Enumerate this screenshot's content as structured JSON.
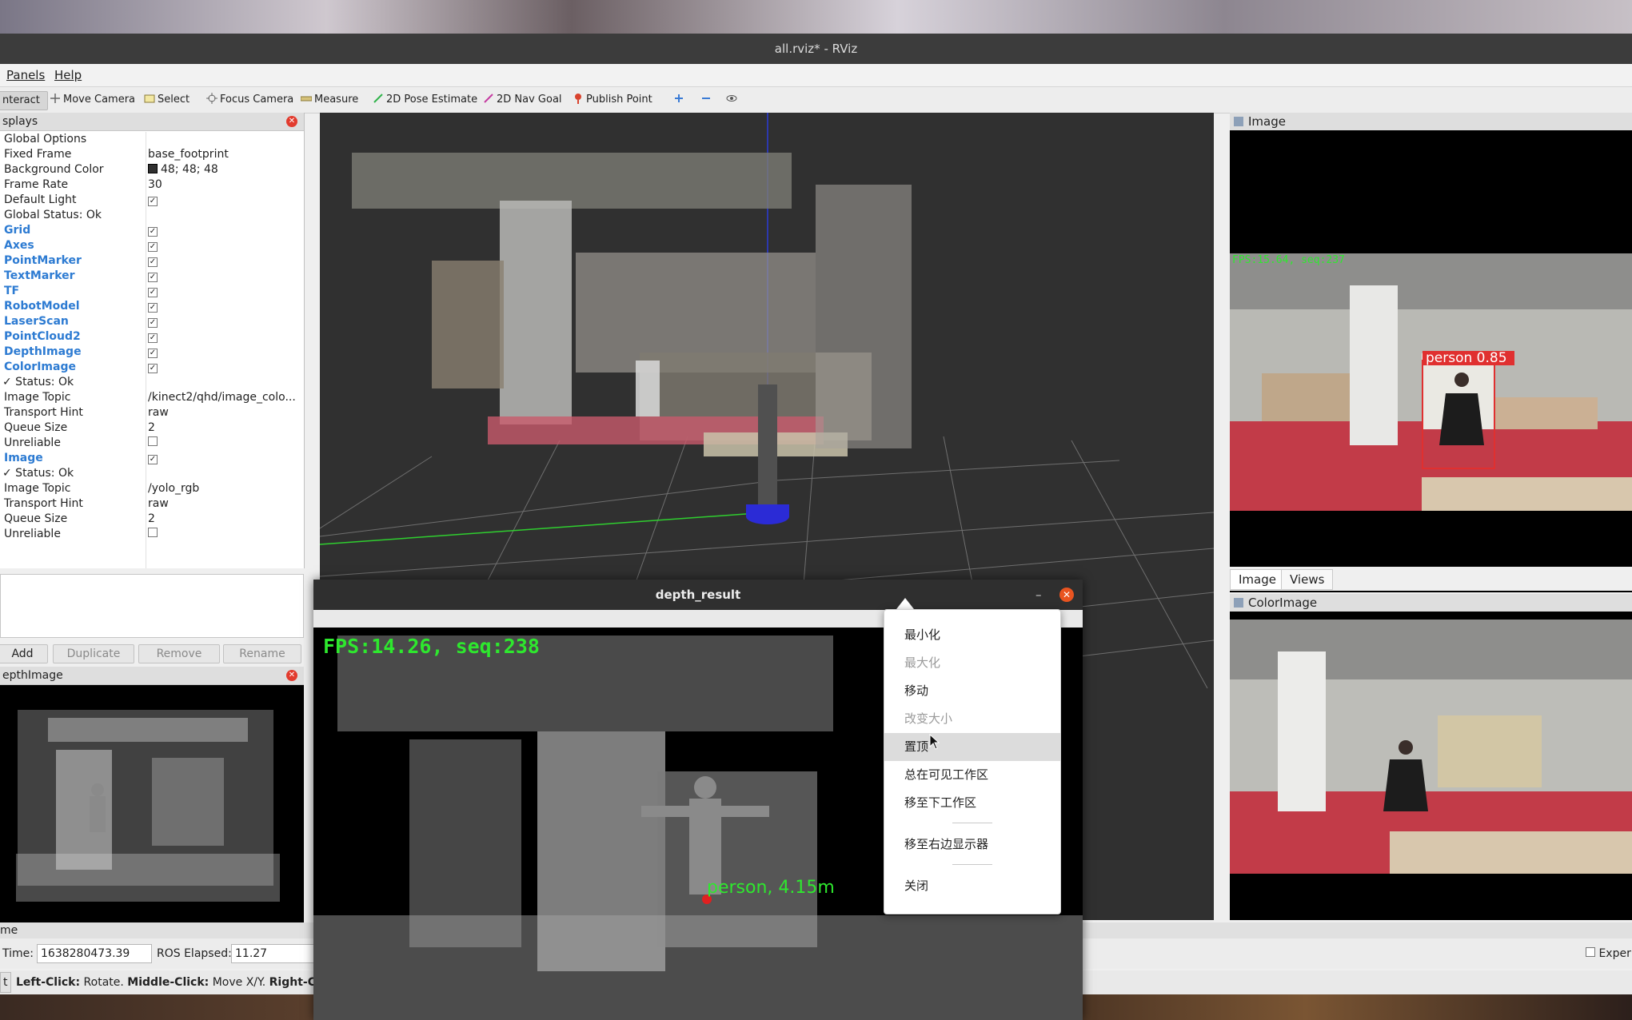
{
  "window": {
    "title": "all.rviz* - RViz"
  },
  "menubar": {
    "items": [
      "Panels",
      "Help"
    ]
  },
  "toolbar": {
    "tools": [
      {
        "label": "nteract",
        "icon": "hand-icon",
        "active": true
      },
      {
        "label": "Move Camera",
        "icon": "move-camera-icon"
      },
      {
        "label": "Select",
        "icon": "select-icon"
      },
      {
        "label": "Focus Camera",
        "icon": "focus-camera-icon"
      },
      {
        "label": "Measure",
        "icon": "measure-icon"
      },
      {
        "label": "2D Pose Estimate",
        "icon": "pose-estimate-icon",
        "color": "#2fb34a"
      },
      {
        "label": "2D Nav Goal",
        "icon": "nav-goal-icon",
        "color": "#c53aa0"
      },
      {
        "label": "Publish Point",
        "icon": "publish-point-icon",
        "color": "#d9432e"
      }
    ]
  },
  "displays": {
    "title": "splays",
    "rows": [
      {
        "key": "Global Options",
        "value": ""
      },
      {
        "key": "Fixed Frame",
        "value": "base_footprint"
      },
      {
        "key": "Background Color",
        "value": "48; 48; 48",
        "swatch": "#303030"
      },
      {
        "key": "Frame Rate",
        "value": "30"
      },
      {
        "key": "Default Light",
        "value": "✓"
      },
      {
        "key": "Global Status: Ok",
        "value": ""
      },
      {
        "key": "Grid",
        "value": "✓",
        "blue": true
      },
      {
        "key": "Axes",
        "value": "✓",
        "blue": true
      },
      {
        "key": "PointMarker",
        "value": "✓",
        "blue": true
      },
      {
        "key": "TextMarker",
        "value": "✓",
        "blue": true
      },
      {
        "key": "TF",
        "value": "✓",
        "blue": true
      },
      {
        "key": "RobotModel",
        "value": "✓",
        "blue": true
      },
      {
        "key": "LaserScan",
        "value": "✓",
        "blue": true
      },
      {
        "key": "PointCloud2",
        "value": "✓",
        "blue": true
      },
      {
        "key": "DepthImage",
        "value": "✓",
        "blue": true
      },
      {
        "key": "ColorImage",
        "value": "✓",
        "blue": true
      },
      {
        "key": "✓ Status: Ok",
        "value": ""
      },
      {
        "key": "Image Topic",
        "value": "/kinect2/qhd/image_colo..."
      },
      {
        "key": "Transport Hint",
        "value": "raw"
      },
      {
        "key": "Queue Size",
        "value": "2"
      },
      {
        "key": "Unreliable",
        "value": ""
      },
      {
        "key": "Image",
        "value": "✓",
        "blue": true
      },
      {
        "key": "✓ Status: Ok",
        "value": ""
      },
      {
        "key": "Image Topic",
        "value": "/yolo_rgb"
      },
      {
        "key": "Transport Hint",
        "value": "raw"
      },
      {
        "key": "Queue Size",
        "value": "2"
      },
      {
        "key": "Unreliable",
        "value": ""
      }
    ],
    "buttons": [
      "Add",
      "Duplicate",
      "Remove",
      "Rename"
    ]
  },
  "depth_panel": {
    "title": "epthImage"
  },
  "image_panel": {
    "title": "Image",
    "overlay": "FPS:15.64, seq:237",
    "detection": "person  0.85"
  },
  "tabs": [
    "Image",
    "Views"
  ],
  "color_panel": {
    "title": "ColorImage"
  },
  "depth_window": {
    "title": "depth_result",
    "overlay": "FPS:14.26, seq:238",
    "detection": "person, 4.15m"
  },
  "context_menu": {
    "items": [
      "最小化",
      "最大化",
      "移动",
      "改变大小",
      "置顶",
      "总在可见工作区",
      "移至下工作区",
      "移至右边显示器",
      "关闭"
    ]
  },
  "timebar": {
    "header": "me",
    "time_label": "Time:",
    "time_value": "1638280473.39",
    "elapsed_label": "ROS Elapsed:",
    "elapsed_value": "11.27",
    "experimental": "Exper"
  },
  "statusbar": {
    "reset": "t",
    "left": "Left-Click:",
    "left_action": "Rotate.",
    "middle": "Middle-Click:",
    "middle_action": "Move X/Y.",
    "right": "Right-Clic"
  },
  "colors": {
    "panel_bg": "#efefef",
    "view_bg": "#303030",
    "accent_blue": "#2d7bd2",
    "close_red": "#e23b2e"
  }
}
